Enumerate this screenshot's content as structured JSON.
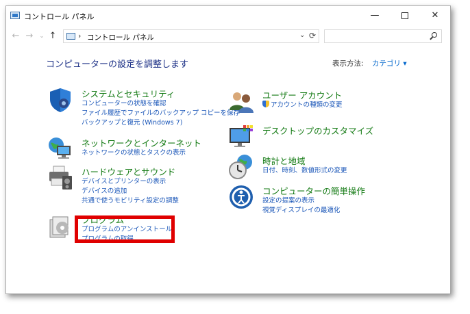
{
  "window": {
    "title": "コントロール パネル",
    "minimize": "—",
    "close": "✕"
  },
  "nav": {
    "back": "←",
    "forward": "→",
    "recent": "⌄",
    "up": "↑",
    "address_separator": "›",
    "address": "コントロール パネル",
    "address_dropdown": "⌄",
    "refresh": "⟳",
    "search_placeholder": ""
  },
  "content": {
    "heading": "コンピューターの設定を調整します",
    "view_by_label": "表示方法:",
    "view_by_value": "カテゴリ ▾"
  },
  "left_categories": [
    {
      "title": "システムとセキュリティ",
      "icon": "shield-icon",
      "links": [
        "コンピューターの状態を確認",
        "ファイル履歴でファイルのバックアップ コピーを保存",
        "バックアップと復元 (Windows 7)"
      ]
    },
    {
      "title": "ネットワークとインターネット",
      "icon": "network-icon",
      "links": [
        "ネットワークの状態とタスクの表示"
      ]
    },
    {
      "title": "ハードウェアとサウンド",
      "icon": "printer-icon",
      "links": [
        "デバイスとプリンターの表示",
        "デバイスの追加",
        "共通で使うモビリティ設定の調整"
      ]
    },
    {
      "title": "プログラム",
      "icon": "programs-icon",
      "links": [
        "プログラムのアンインストール",
        "プログラムの取得"
      ]
    }
  ],
  "right_categories": [
    {
      "title": "ユーザー アカウント",
      "icon": "users-icon",
      "links": [
        "アカウントの種類の変更"
      ]
    },
    {
      "title": "デスクトップのカスタマイズ",
      "icon": "monitor-icon",
      "links": []
    },
    {
      "title": "時計と地域",
      "icon": "clock-globe-icon",
      "links": [
        "日付、時刻、数値形式の変更"
      ]
    },
    {
      "title": "コンピューターの簡単操作",
      "icon": "ease-of-access-icon",
      "links": [
        "設定の提案の表示",
        "視覚ディスプレイの最適化"
      ]
    }
  ],
  "colors": {
    "heading": "#1e3287",
    "category_title": "#137a13",
    "link": "#1a56b8",
    "highlight": "#e00000"
  }
}
